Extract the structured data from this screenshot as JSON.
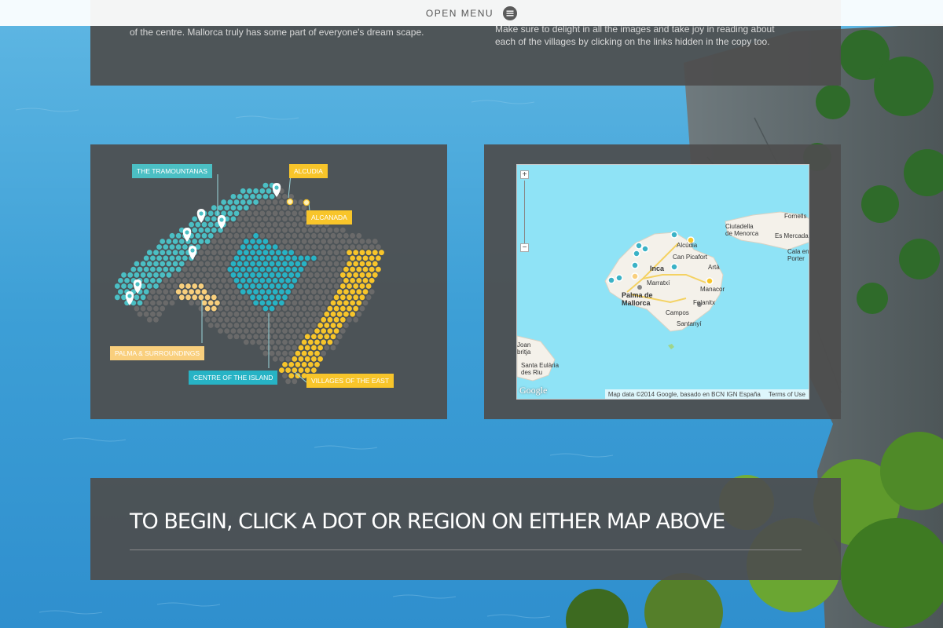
{
  "header": {
    "menu_label": "OPEN MENU",
    "menu_icon": "hamburger-circle-icon"
  },
  "intro": {
    "left_lines": [
      "of the centre. Mallorca truly has some part of everyone's dream scape."
    ],
    "right_lines": [
      "Make sure to delight in all the images and take joy in reading about",
      "each of the villages by clicking on the links hidden in the copy too."
    ]
  },
  "illustrated_map": {
    "regions": [
      {
        "label": "THE TRAMOUNTANAS",
        "color": "#4bbfc4",
        "text_color": "#ffffff"
      },
      {
        "label": "ALCUDIA",
        "color": "#f8c52a",
        "text_color": "#ffffff"
      },
      {
        "label": "ALCANADA",
        "color": "#f8c52a",
        "text_color": "#ffffff"
      },
      {
        "label": "PALMA & SURROUNDINGS",
        "color": "#f9cf7d",
        "text_color": "#ffffff"
      },
      {
        "label": "CENTRE OF THE ISLAND",
        "color": "#27b3c5",
        "text_color": "#ffffff"
      },
      {
        "label": "VILLAGES OF THE EAST",
        "color": "#f8c52a",
        "text_color": "#ffffff"
      }
    ],
    "colors": {
      "land": "#6a6a6a",
      "teal": "#4bbfc4",
      "cyan": "#27b3c5",
      "yellow": "#f8c52a",
      "peach": "#f9cf7d"
    }
  },
  "google_map": {
    "zoom_in": "+",
    "zoom_out": "−",
    "labels": {
      "ciutadella": "Ciutadella\nde Menorca",
      "fornells": "Fornells",
      "es_mercadal": "Es Mercadal",
      "cala_en_porter": "Cala en\nPorter",
      "alcudia": "Alcúdia",
      "can_picafort": "Can Picafort",
      "inca": "Inca",
      "arta": "Artà",
      "marratxi": "Marratxí",
      "manacor": "Manacor",
      "palma": "Palma de\nMallorca",
      "felanitx": "Felanitx",
      "campos": "Campos",
      "santanyi": "Santanyí",
      "joan": "Joan\nbritja",
      "santa_eularia": "Santa Eulària\ndes Riu"
    },
    "attribution": "Map data ©2014 Google, basado en BCN IGN España",
    "terms": "Terms of Use",
    "logo": "Google"
  },
  "cta": {
    "title": "TO BEGIN, CLICK A DOT OR REGION ON EITHER MAP ABOVE"
  }
}
